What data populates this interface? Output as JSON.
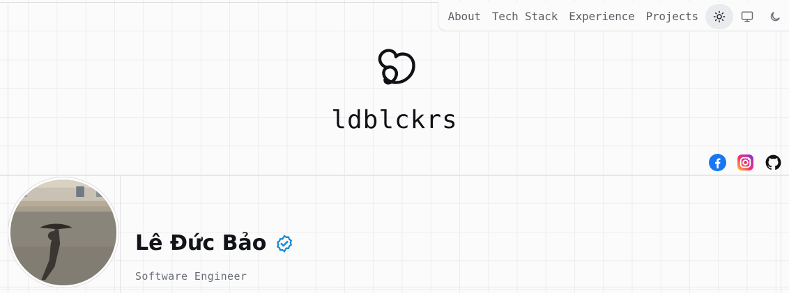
{
  "nav": {
    "links": [
      "About",
      "Tech Stack",
      "Experience",
      "Projects"
    ],
    "theme_options": [
      "sun-icon",
      "monitor-icon",
      "moon-icon"
    ],
    "active_theme": "sun-icon"
  },
  "brand": {
    "name": "ldblckrs",
    "logo_icon": "brand-logo-icon"
  },
  "social": [
    "facebook-icon",
    "instagram-icon",
    "github-icon"
  ],
  "profile": {
    "name": "Lê Đức Bảo",
    "verified_icon": "verified-badge-icon",
    "title": "Software Engineer"
  },
  "colors": {
    "facebook": "#1877f2",
    "verified": "#1a8cd8",
    "text_muted": "#6a6f77"
  }
}
